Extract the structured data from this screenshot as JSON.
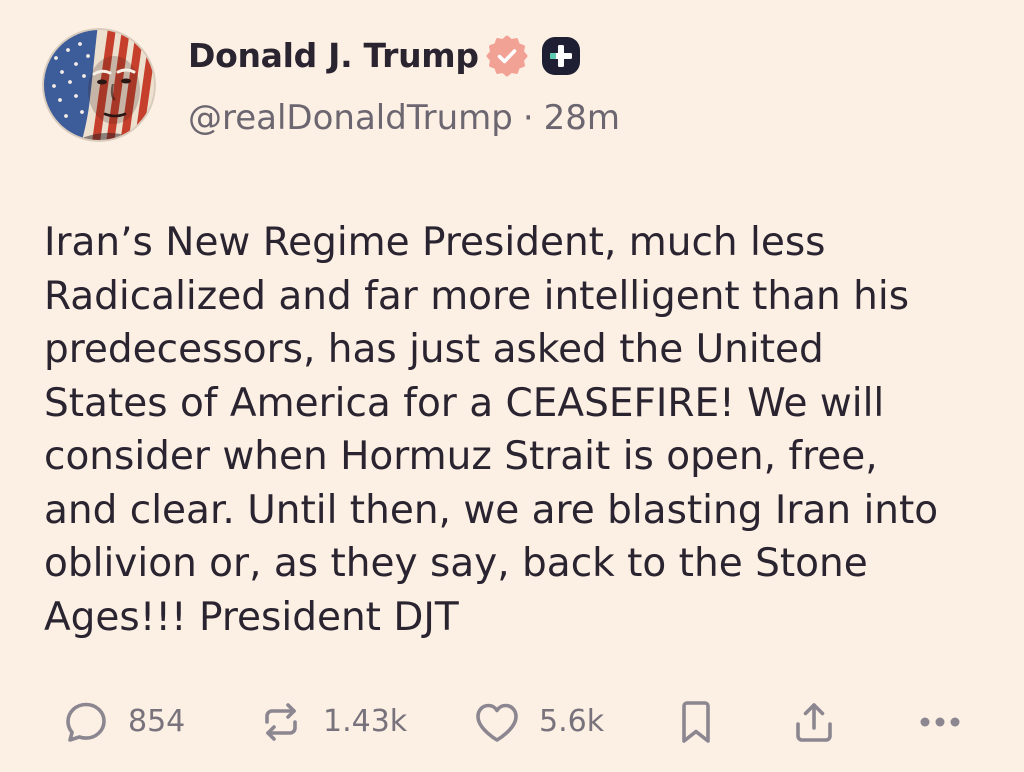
{
  "theme": {
    "background": "#FCEFE3",
    "text": "#2A2431",
    "muted_text": "#6B6670",
    "icon": "#8B8690",
    "count_text": "#77727B",
    "verified_badge": "#F2A195",
    "plus_badge": "#1E1F32"
  },
  "post": {
    "author": {
      "name": "Donald J. Trump",
      "badges": [
        "verified-badge-icon",
        "truth-plus-icon"
      ],
      "handle": "@realDonaldTrump",
      "separator": "·",
      "time": "28m"
    },
    "body_lines": [
      "Iran’s New Regime President, much less",
      "Radicalized and far more intelligent than his",
      "predecessors, has just asked the United",
      "States of America for a CEASEFIRE! We will",
      "consider when Hormuz Strait is open, free,",
      "and clear. Until then, we are blasting Iran into",
      "oblivion or, as they say, back to the Stone",
      "Ages!!! President DJT"
    ],
    "actions": [
      {
        "icon": "reply-icon",
        "count": "854"
      },
      {
        "icon": "repost-icon",
        "count": "1.43k"
      },
      {
        "icon": "like-icon",
        "count": "5.6k"
      },
      {
        "icon": "bookmark-icon"
      },
      {
        "icon": "share-icon"
      },
      {
        "icon": "more-icon"
      }
    ]
  }
}
